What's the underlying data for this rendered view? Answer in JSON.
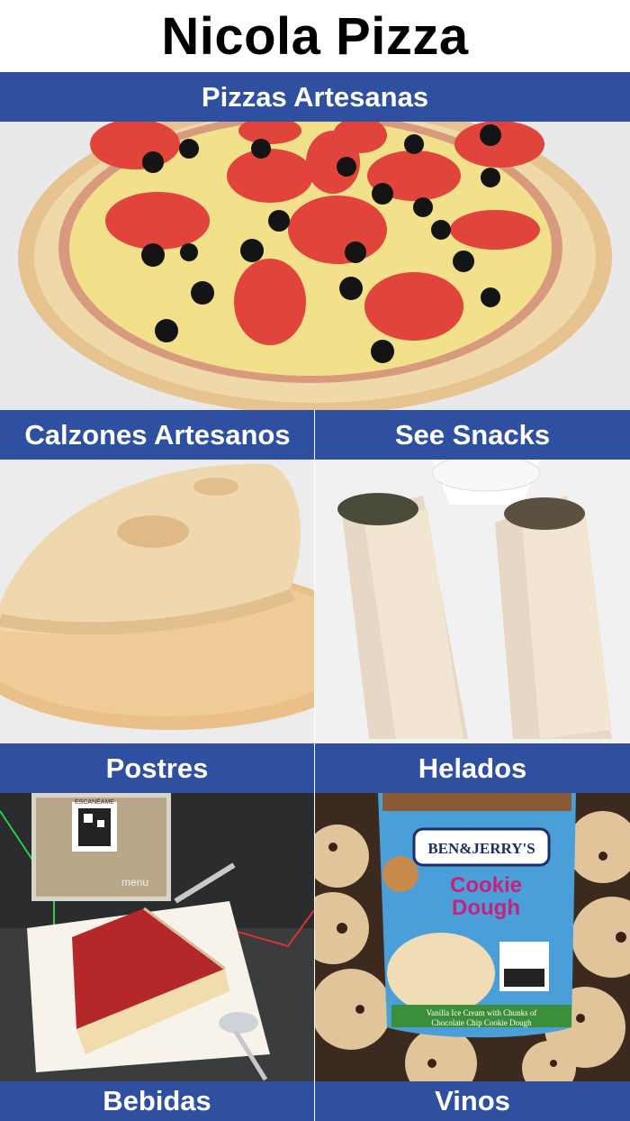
{
  "header": {
    "title": "Nicola Pizza"
  },
  "categories": [
    {
      "label": "Pizzas Artesanas",
      "image": "pizza-photo"
    },
    {
      "label": "Calzones Artesanos",
      "image": "calzone-photo"
    },
    {
      "label": "See Snacks",
      "image": "wraps-photo"
    },
    {
      "label": "Postres",
      "image": "cheesecake-photo"
    },
    {
      "label": "Helados",
      "image": "ice-cream-photo"
    },
    {
      "label": "Bebidas",
      "image": ""
    },
    {
      "label": "Vinos",
      "image": ""
    }
  ],
  "images": {
    "cheesecake_sign": {
      "scan_text": "ESCANÉAME",
      "menu_text": "menu"
    },
    "ice_cream_pint": {
      "brand": "BEN&JERRY'S",
      "flavor_line1": "Cookie",
      "flavor_line2": "Dough",
      "desc_line1": "Vanilla Ice Cream with Chunks of",
      "desc_line2": "Chocolate Chip Cookie Dough"
    }
  },
  "colors": {
    "category_bar": "#2f4fa0",
    "bar_text": "#ffffff",
    "title_text": "#000000"
  }
}
